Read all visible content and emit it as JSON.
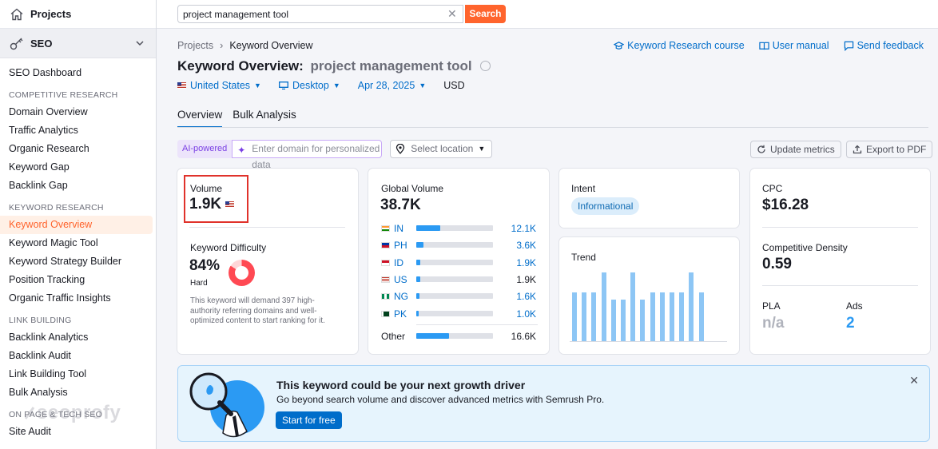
{
  "sidebar": {
    "projects_label": "Projects",
    "seo_label": "SEO",
    "items": [
      {
        "type": "item",
        "label": "SEO Dashboard"
      },
      {
        "type": "section",
        "label": "COMPETITIVE RESEARCH"
      },
      {
        "type": "item",
        "label": "Domain Overview"
      },
      {
        "type": "item",
        "label": "Traffic Analytics"
      },
      {
        "type": "item",
        "label": "Organic Research"
      },
      {
        "type": "item",
        "label": "Keyword Gap"
      },
      {
        "type": "item",
        "label": "Backlink Gap"
      },
      {
        "type": "section",
        "label": "KEYWORD RESEARCH"
      },
      {
        "type": "item",
        "label": "Keyword Overview",
        "active": true
      },
      {
        "type": "item",
        "label": "Keyword Magic Tool"
      },
      {
        "type": "item",
        "label": "Keyword Strategy Builder"
      },
      {
        "type": "item",
        "label": "Position Tracking"
      },
      {
        "type": "item",
        "label": "Organic Traffic Insights"
      },
      {
        "type": "section",
        "label": "LINK BUILDING"
      },
      {
        "type": "item",
        "label": "Backlink Analytics"
      },
      {
        "type": "item",
        "label": "Backlink Audit"
      },
      {
        "type": "item",
        "label": "Link Building Tool"
      },
      {
        "type": "item",
        "label": "Bulk Analysis"
      },
      {
        "type": "section",
        "label": "ON PAGE & TECH SEO"
      },
      {
        "type": "item",
        "label": "Site Audit"
      }
    ],
    "watermark": "seoprofy"
  },
  "search": {
    "value": "project management tool",
    "clear_icon": "close-icon",
    "button_label": "Search"
  },
  "breadcrumb": {
    "root": "Projects",
    "current": "Keyword Overview"
  },
  "toplinks": {
    "course": "Keyword Research course",
    "manual": "User manual",
    "feedback": "Send feedback"
  },
  "title": {
    "prefix": "Keyword Overview:",
    "keyword": "project management tool"
  },
  "filters": {
    "country": "United States",
    "device": "Desktop",
    "date": "Apr 28, 2025",
    "currency": "USD"
  },
  "tabs": [
    "Overview",
    "Bulk Analysis"
  ],
  "ai": {
    "badge": "AI-powered",
    "placeholder": "Enter domain for personalized data"
  },
  "location": {
    "placeholder": "Select location"
  },
  "actions": {
    "update": "Update metrics",
    "export": "Export to PDF"
  },
  "volume": {
    "label": "Volume",
    "value": "1.9K"
  },
  "kd": {
    "label": "Keyword Difficulty",
    "value": "84%",
    "level": "Hard",
    "percent": 84,
    "note_lines": [
      "This keyword will demand 397 high-",
      "authority referring domains and well-",
      "optimized content to start ranking for it."
    ]
  },
  "global_volume": {
    "label": "Global Volume",
    "value": "38.7K",
    "countries": [
      {
        "code": "IN",
        "value": "12.1K",
        "fill": 0.31,
        "link": true
      },
      {
        "code": "PH",
        "value": "3.6K",
        "fill": 0.09,
        "link": true
      },
      {
        "code": "ID",
        "value": "1.9K",
        "fill": 0.05,
        "link": true
      },
      {
        "code": "US",
        "value": "1.9K",
        "fill": 0.05,
        "link": false
      },
      {
        "code": "NG",
        "value": "1.6K",
        "fill": 0.04,
        "link": true
      },
      {
        "code": "PK",
        "value": "1.0K",
        "fill": 0.03,
        "link": true
      }
    ],
    "other": {
      "label": "Other",
      "value": "16.6K",
      "fill": 0.43
    }
  },
  "intent": {
    "label": "Intent",
    "value": "Informational"
  },
  "trend": {
    "label": "Trend",
    "values": [
      0.71,
      0.71,
      0.71,
      1.0,
      0.6,
      0.6,
      1.0,
      0.6,
      0.71,
      0.71,
      0.71,
      0.71,
      1.0,
      0.71
    ]
  },
  "cpc": {
    "label": "CPC",
    "value": "$16.28"
  },
  "density": {
    "label": "Competitive Density",
    "value": "0.59"
  },
  "pla": {
    "label": "PLA",
    "value": "n/a"
  },
  "ads": {
    "label": "Ads",
    "value": "2"
  },
  "promo": {
    "title": "This keyword could be your next growth driver",
    "subtitle": "Go beyond search volume and discover advanced metrics with Semrush Pro.",
    "button": "Start for free"
  },
  "colors": {
    "accent": "#ff642d",
    "link": "#006dca",
    "bar": "#2b9af3",
    "kd": "#ff4953"
  }
}
